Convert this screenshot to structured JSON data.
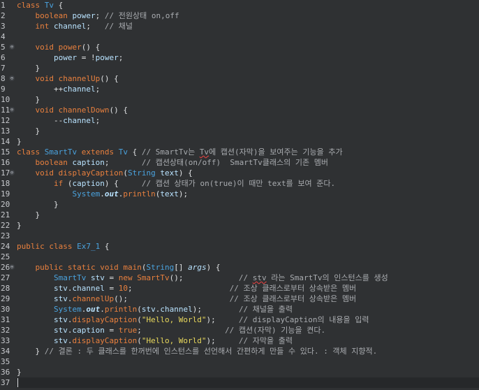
{
  "editor": {
    "line_numbers": [
      "1",
      "2",
      "3",
      "4",
      "5",
      "6",
      "7",
      "8",
      "9",
      "10",
      "11",
      "12",
      "13",
      "14",
      "15",
      "16",
      "17",
      "18",
      "19",
      "20",
      "21",
      "22",
      "23",
      "24",
      "25",
      "26",
      "27",
      "28",
      "29",
      "30",
      "31",
      "32",
      "33",
      "34",
      "35",
      "36",
      "37"
    ],
    "fold_markers": [
      "5",
      "8",
      "11",
      "17",
      "26"
    ],
    "fold_marker_glyph": "⊖",
    "lines": [
      [
        [
          "kw",
          "class"
        ],
        [
          "pl",
          " "
        ],
        [
          "cls",
          "Tv"
        ],
        [
          "pl",
          " {"
        ]
      ],
      [
        [
          "pl",
          "    "
        ],
        [
          "kw",
          "boolean"
        ],
        [
          "pl",
          " "
        ],
        [
          "field",
          "power"
        ],
        [
          "pl",
          "; "
        ],
        [
          "cm",
          "// 전원상태 on,off"
        ]
      ],
      [
        [
          "pl",
          "    "
        ],
        [
          "kw",
          "int"
        ],
        [
          "pl",
          " "
        ],
        [
          "field",
          "channel"
        ],
        [
          "pl",
          ";   "
        ],
        [
          "cm",
          "// 채널"
        ]
      ],
      [],
      [
        [
          "pl",
          "    "
        ],
        [
          "kw",
          "void"
        ],
        [
          "pl",
          " "
        ],
        [
          "fn",
          "power"
        ],
        [
          "pl",
          "() {"
        ]
      ],
      [
        [
          "pl",
          "        "
        ],
        [
          "field",
          "power"
        ],
        [
          "pl",
          " = !"
        ],
        [
          "field",
          "power"
        ],
        [
          "pl",
          ";"
        ]
      ],
      [
        [
          "pl",
          "    }"
        ]
      ],
      [
        [
          "pl",
          "    "
        ],
        [
          "kw",
          "void"
        ],
        [
          "pl",
          " "
        ],
        [
          "fn",
          "channelUp"
        ],
        [
          "pl",
          "() {"
        ]
      ],
      [
        [
          "pl",
          "        ++"
        ],
        [
          "field",
          "channel"
        ],
        [
          "pl",
          ";"
        ]
      ],
      [
        [
          "pl",
          "    }"
        ]
      ],
      [
        [
          "pl",
          "    "
        ],
        [
          "kw",
          "void"
        ],
        [
          "pl",
          " "
        ],
        [
          "fn",
          "channelDown"
        ],
        [
          "pl",
          "() {"
        ]
      ],
      [
        [
          "pl",
          "        --"
        ],
        [
          "field",
          "channel"
        ],
        [
          "pl",
          ";"
        ]
      ],
      [
        [
          "pl",
          "    }"
        ]
      ],
      [
        [
          "pl",
          "}"
        ]
      ],
      [
        [
          "kw",
          "class"
        ],
        [
          "pl",
          " "
        ],
        [
          "cls",
          "SmartTv"
        ],
        [
          "pl",
          " "
        ],
        [
          "kw",
          "extends"
        ],
        [
          "pl",
          " "
        ],
        [
          "cls",
          "Tv"
        ],
        [
          "pl",
          " { "
        ],
        [
          "cm",
          "// SmartTv는 "
        ],
        [
          "cmsq",
          "Tv"
        ],
        [
          "cm",
          "에 캡션(자막)을 보여주는 기능을 추가"
        ]
      ],
      [
        [
          "pl",
          "    "
        ],
        [
          "kw",
          "boolean"
        ],
        [
          "pl",
          " "
        ],
        [
          "field",
          "caption"
        ],
        [
          "pl",
          ";       "
        ],
        [
          "cm",
          "// 캡션상태(on/off)  SmartTv클래스의 기존 멤버"
        ]
      ],
      [
        [
          "pl",
          "    "
        ],
        [
          "kw",
          "void"
        ],
        [
          "pl",
          " "
        ],
        [
          "fn",
          "displayCaption"
        ],
        [
          "pl",
          "("
        ],
        [
          "type",
          "String"
        ],
        [
          "pl",
          " "
        ],
        [
          "field",
          "text"
        ],
        [
          "pl",
          ") {"
        ]
      ],
      [
        [
          "pl",
          "        "
        ],
        [
          "kw",
          "if"
        ],
        [
          "pl",
          " ("
        ],
        [
          "field",
          "caption"
        ],
        [
          "pl",
          ") {     "
        ],
        [
          "cm",
          "// 캡션 상태가 on(true)이 때만 text를 보여 준다."
        ]
      ],
      [
        [
          "pl",
          "            "
        ],
        [
          "sys",
          "System"
        ],
        [
          "pl",
          "."
        ],
        [
          "static",
          "out"
        ],
        [
          "pl",
          "."
        ],
        [
          "fn",
          "println"
        ],
        [
          "pl",
          "("
        ],
        [
          "field",
          "text"
        ],
        [
          "pl",
          ");"
        ]
      ],
      [
        [
          "pl",
          "        }"
        ]
      ],
      [
        [
          "pl",
          "    }"
        ]
      ],
      [
        [
          "pl",
          "}"
        ]
      ],
      [],
      [
        [
          "kw",
          "public"
        ],
        [
          "pl",
          " "
        ],
        [
          "kw",
          "class"
        ],
        [
          "pl",
          " "
        ],
        [
          "cls",
          "Ex7_1"
        ],
        [
          "pl",
          " {"
        ]
      ],
      [],
      [
        [
          "pl",
          "    "
        ],
        [
          "kw",
          "public"
        ],
        [
          "pl",
          " "
        ],
        [
          "kw",
          "static"
        ],
        [
          "pl",
          " "
        ],
        [
          "kw",
          "void"
        ],
        [
          "pl",
          " "
        ],
        [
          "fn",
          "main"
        ],
        [
          "pl",
          "("
        ],
        [
          "type",
          "String"
        ],
        [
          "pl",
          "[] "
        ],
        [
          "ital",
          "args"
        ],
        [
          "pl",
          ") {"
        ]
      ],
      [
        [
          "pl",
          "        "
        ],
        [
          "type",
          "SmartTv"
        ],
        [
          "pl",
          " "
        ],
        [
          "field",
          "stv"
        ],
        [
          "pl",
          " = "
        ],
        [
          "kw",
          "new"
        ],
        [
          "pl",
          " "
        ],
        [
          "fn",
          "SmartTv"
        ],
        [
          "pl",
          "();            "
        ],
        [
          "cm",
          "// "
        ],
        [
          "cmsq",
          "stv"
        ],
        [
          "cm",
          " 라는 SmartTv의 인스턴스를 생성"
        ]
      ],
      [
        [
          "pl",
          "        "
        ],
        [
          "field",
          "stv"
        ],
        [
          "pl",
          "."
        ],
        [
          "field",
          "channel"
        ],
        [
          "pl",
          " = "
        ],
        [
          "num",
          "10"
        ],
        [
          "pl",
          ";                     "
        ],
        [
          "cm",
          "// 조상 클래스로부터 상속받은 멤버"
        ]
      ],
      [
        [
          "pl",
          "        "
        ],
        [
          "field",
          "stv"
        ],
        [
          "pl",
          "."
        ],
        [
          "fn",
          "channelUp"
        ],
        [
          "pl",
          "();                      "
        ],
        [
          "cm",
          "// 조상 클래스로부터 상속받은 멤버"
        ]
      ],
      [
        [
          "pl",
          "        "
        ],
        [
          "sys",
          "System"
        ],
        [
          "pl",
          "."
        ],
        [
          "static",
          "out"
        ],
        [
          "pl",
          "."
        ],
        [
          "fn",
          "println"
        ],
        [
          "pl",
          "("
        ],
        [
          "field",
          "stv"
        ],
        [
          "pl",
          "."
        ],
        [
          "field",
          "channel"
        ],
        [
          "pl",
          ");        "
        ],
        [
          "cm",
          "// 채널을 출력"
        ]
      ],
      [
        [
          "pl",
          "        "
        ],
        [
          "field",
          "stv"
        ],
        [
          "pl",
          "."
        ],
        [
          "fn",
          "displayCaption"
        ],
        [
          "pl",
          "("
        ],
        [
          "str",
          "\"Hello, World\""
        ],
        [
          "pl",
          ");     "
        ],
        [
          "cm",
          "// displayCaption의 내용을 입력"
        ]
      ],
      [
        [
          "pl",
          "        "
        ],
        [
          "field",
          "stv"
        ],
        [
          "pl",
          "."
        ],
        [
          "field",
          "caption"
        ],
        [
          "pl",
          " = "
        ],
        [
          "kw",
          "true"
        ],
        [
          "pl",
          ";                  "
        ],
        [
          "cm",
          "// 캡션(자막) 기능을 켠다."
        ]
      ],
      [
        [
          "pl",
          "        "
        ],
        [
          "field",
          "stv"
        ],
        [
          "pl",
          "."
        ],
        [
          "fn",
          "displayCaption"
        ],
        [
          "pl",
          "("
        ],
        [
          "str",
          "\"Hello, World\""
        ],
        [
          "pl",
          ");     "
        ],
        [
          "cm",
          "// 자막을 출력"
        ]
      ],
      [
        [
          "pl",
          "    } "
        ],
        [
          "cm",
          "// 결론 : 두 클래스를 한꺼번에 인스턴스를 선언해서 간편하게 만들 수 있다. : 객체 지향적."
        ]
      ],
      [],
      [
        [
          "pl",
          "}"
        ]
      ],
      []
    ]
  },
  "colors": {
    "background": "#2f3133",
    "keyword": "#e9803e",
    "type": "#4aa3df",
    "string": "#e7d75c",
    "comment": "#a9acb0",
    "field": "#b9e3ff"
  }
}
